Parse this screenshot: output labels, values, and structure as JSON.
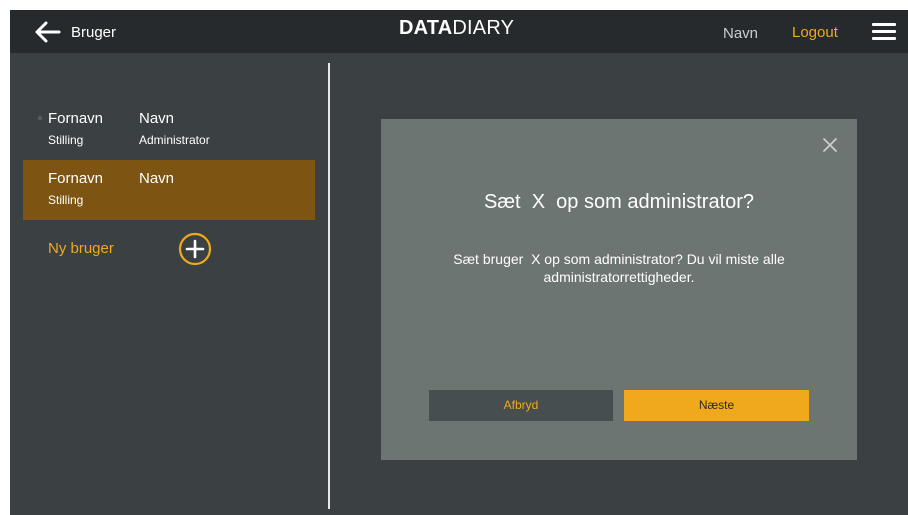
{
  "header": {
    "back_label": "Bruger",
    "logo_bold": "DATA",
    "logo_light": "DIARY",
    "user_name": "Navn",
    "logout_label": "Logout"
  },
  "sidebar": {
    "users": [
      {
        "first_name": "Fornavn",
        "last_name": "Navn",
        "position": "Stilling",
        "role": "Administrator",
        "selected": false
      },
      {
        "first_name": "Fornavn",
        "last_name": "Navn",
        "position": "Stilling",
        "role": "",
        "selected": true
      }
    ],
    "new_user_label": "Ny bruger"
  },
  "modal": {
    "title": "Sæt  X  op som administrator?",
    "body": "Sæt bruger  X op som administrator? Du vil miste alle administratorrettigheder.",
    "cancel_label": "Afbryd",
    "next_label": "Næste"
  },
  "colors": {
    "accent": "#f0a81c",
    "selected_card": "#7d5412",
    "topbar": "#262a2c",
    "background": "#3b4143",
    "modal": "#6c7572"
  },
  "icons": {
    "back": "arrow-left-icon",
    "menu": "hamburger-menu-icon",
    "add": "plus-circle-icon",
    "close": "close-icon"
  }
}
